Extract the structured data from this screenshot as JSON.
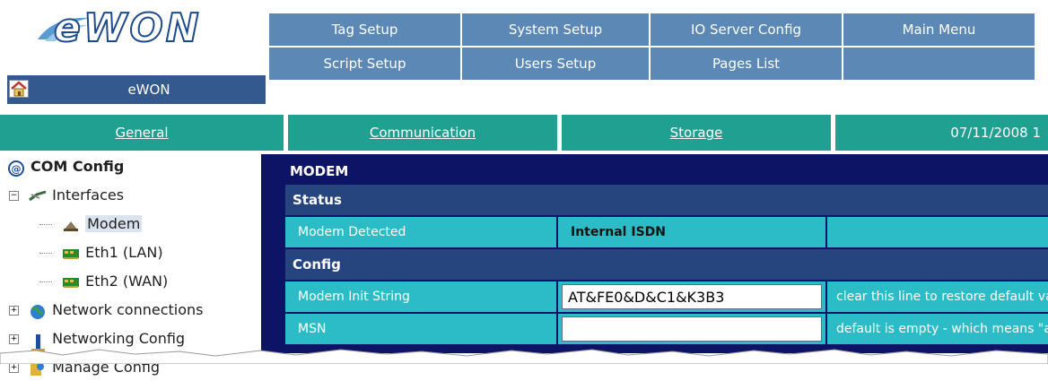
{
  "logo": {
    "text": "eWON"
  },
  "home": {
    "label": "eWON"
  },
  "top_menu": {
    "row1": [
      "Tag Setup",
      "System Setup",
      "IO Server Config",
      "Main Menu"
    ],
    "row2": [
      "Script Setup",
      "Users Setup",
      "Pages List",
      ""
    ]
  },
  "tabs": [
    "General",
    "Communication",
    "Storage",
    "07/11/2008 1"
  ],
  "tree": {
    "root": "COM Config",
    "interfaces": "Interfaces",
    "modem": "Modem",
    "eth1": "Eth1 (LAN)",
    "eth2": "Eth2 (WAN)",
    "network_connections": "Network connections",
    "networking_config": "Networking Config",
    "manage_config": "Manage Config"
  },
  "panel": {
    "title": "MODEM",
    "status_heading": "Status",
    "config_heading": "Config",
    "rows": {
      "modem_detected": {
        "label": "Modem Detected",
        "value": "Internal ISDN"
      },
      "init_string": {
        "label": "Modem Init String",
        "value": "AT&FE0&D&C1&K3B3",
        "note": "clear this line to restore default va"
      },
      "msn": {
        "label": "MSN",
        "value": "",
        "note": "default is empty - which means \"al"
      }
    }
  },
  "colors": {
    "menu_blue": "#5b88b5",
    "tab_green": "#20a090",
    "panel_navy": "#0d1465",
    "row_cyan": "#2cbcc8",
    "section_blue": "#26447e"
  },
  "icons": [
    "home-icon",
    "at-icon",
    "network-cable-icon",
    "modem-icon",
    "ethernet-card-icon",
    "globe-icon",
    "network-tower-icon",
    "manage-config-icon",
    "tree-expand-icon"
  ]
}
